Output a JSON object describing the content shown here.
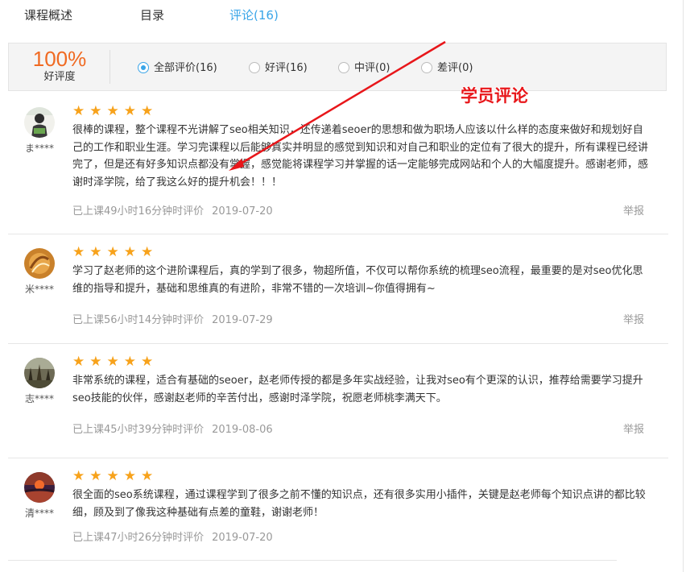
{
  "tabs": [
    {
      "label": "课程概述"
    },
    {
      "label": "目录"
    },
    {
      "label": "评论(16)"
    }
  ],
  "summary": {
    "rate": "100%",
    "rate_label": "好评度",
    "filters": [
      {
        "label": "全部评价(16)",
        "checked": true
      },
      {
        "label": "好评(16)",
        "checked": false
      },
      {
        "label": "中评(0)",
        "checked": false
      },
      {
        "label": "差评(0)",
        "checked": false
      }
    ]
  },
  "annotation": {
    "label": "学员评论",
    "color": "#e8161a"
  },
  "colors": {
    "accent": "#3aa5e8",
    "star": "#f7a21b",
    "rate": "#f06a22"
  },
  "reviews": [
    {
      "user": "ま****",
      "stars": "★★★★★",
      "text": "很棒的课程，整个课程不光讲解了seo相关知识，还传递着seoer的思想和做为职场人应该以什么样的态度来做好和规划好自己的工作和职业生涯。学习完课程以后能够真实并明显的感觉到知识和对自己和职业的定位有了很大的提升，所有课程已经讲完了，但是还有好多知识点都没有掌握，感觉能将课程学习并掌握的话一定能够完成网站和个人的大幅度提升。感谢老师，感谢时泽学院，给了我这么好的提升机会！！！",
      "meta": "已上课49小时16分钟时评价",
      "date": "2019-07-20",
      "report": "举报"
    },
    {
      "user": "米****",
      "stars": "★★★★★",
      "text": "学习了赵老师的这个进阶课程后，真的学到了很多，物超所值，不仅可以帮你系统的梳理seo流程，最重要的是对seo优化思维的指导和提升，基础和思维真的有进阶，非常不错的一次培训~你值得拥有~",
      "meta": "已上课56小时14分钟时评价",
      "date": "2019-07-29",
      "report": "举报"
    },
    {
      "user": "志****",
      "stars": "★★★★★",
      "text": "非常系统的课程，适合有基础的seoer，赵老师传授的都是多年实战经验，让我对seo有个更深的认识，推荐给需要学习提升seo技能的伙伴，感谢赵老师的辛苦付出，感谢时泽学院，祝愿老师桃李满天下。",
      "meta": "已上课45小时39分钟时评价",
      "date": "2019-08-06",
      "report": "举报"
    },
    {
      "user": "清****",
      "stars": "★★★★★",
      "text": "很全面的seo系统课程，通过课程学到了很多之前不懂的知识点，还有很多实用小插件，关键是赵老师每个知识点讲的都比较细，顾及到了像我这种基础有点差的童鞋，谢谢老师！",
      "meta": "已上课47小时26分钟时评价",
      "date": "2019-07-20",
      "report": ""
    }
  ]
}
